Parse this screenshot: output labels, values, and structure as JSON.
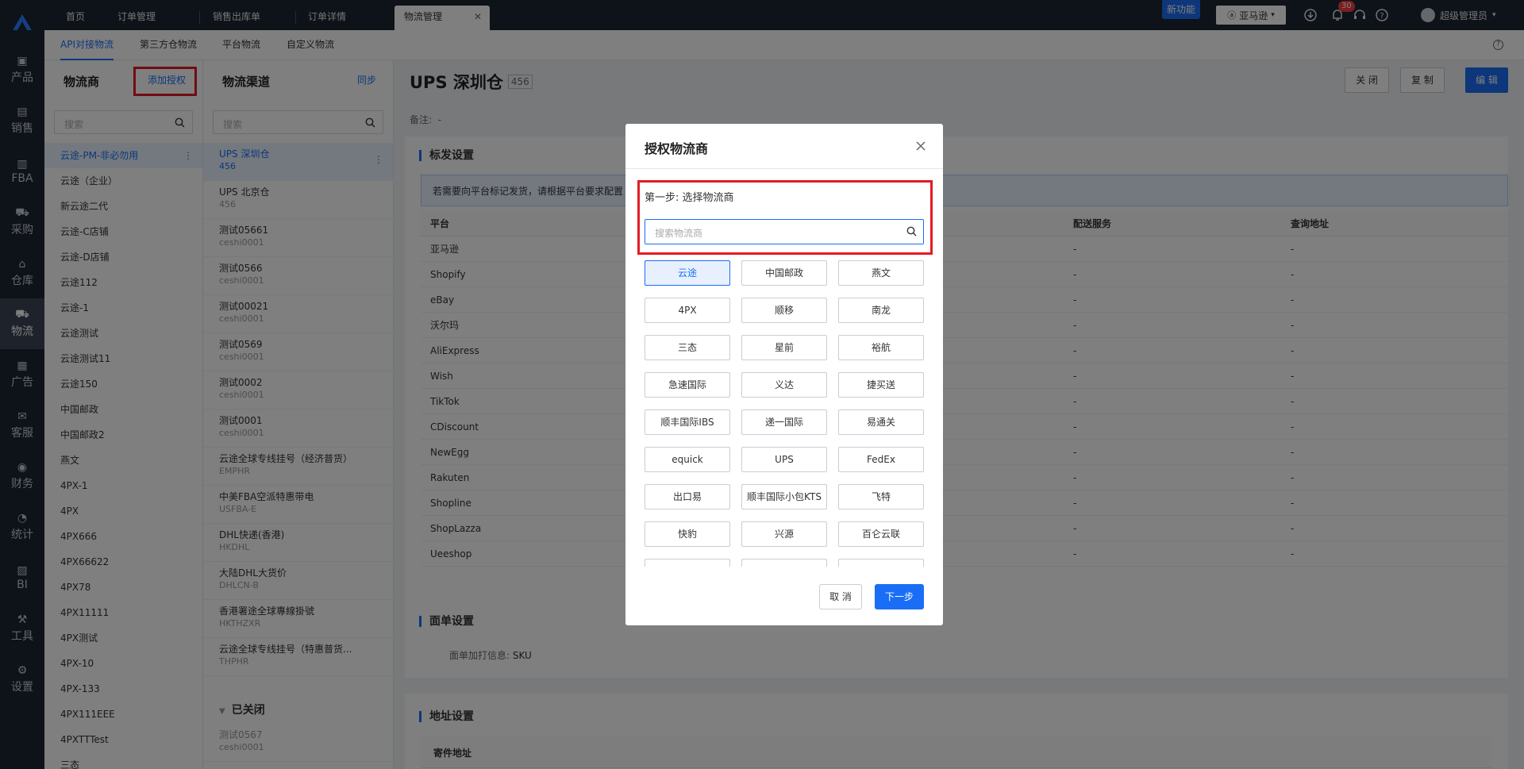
{
  "sidebar": {
    "items": [
      {
        "label": "产品",
        "icon": "box-icon"
      },
      {
        "label": "销售",
        "icon": "sale-icon"
      },
      {
        "label": "FBA",
        "icon": "fba-icon"
      },
      {
        "label": "采购",
        "icon": "cart-icon"
      },
      {
        "label": "仓库",
        "icon": "warehouse-icon"
      },
      {
        "label": "物流",
        "icon": "truck-icon"
      },
      {
        "label": "广告",
        "icon": "ad-icon"
      },
      {
        "label": "客服",
        "icon": "mail-icon"
      },
      {
        "label": "财务",
        "icon": "finance-icon"
      },
      {
        "label": "统计",
        "icon": "pie-chart-icon"
      },
      {
        "label": "BI",
        "icon": "bi-icon"
      },
      {
        "label": "工具",
        "icon": "tool-icon"
      },
      {
        "label": "设置",
        "icon": "gear-icon"
      }
    ]
  },
  "topbar": {
    "tabs": [
      "首页",
      "订单管理",
      "销售出库单",
      "订单详情",
      "物流管理"
    ],
    "new_feature": "新功能",
    "platform": "亚马逊",
    "notification_count": "30",
    "user": "超级管理员"
  },
  "subnav": {
    "tabs": [
      "API对接物流",
      "第三方仓物流",
      "平台物流",
      "自定义物流"
    ]
  },
  "carriers_panel": {
    "title": "物流商",
    "add_label": "添加授权",
    "search_placeholder": "搜索",
    "items": [
      "云途-PM-非必勿用",
      "云途（企业）",
      "新云途二代",
      "云途-C店铺",
      "云途-D店铺",
      "云途112",
      "云途-1",
      "云途测试",
      "云途测试11",
      "云途150",
      "中国邮政",
      "中国邮政2",
      "燕文",
      "4PX-1",
      "4PX",
      "4PX666",
      "4PX66622",
      "4PX78",
      "4PX11111",
      "4PX测试",
      "4PX-10",
      "4PX-133",
      "4PX111EEE",
      "4PXTTTest",
      "三态"
    ]
  },
  "channels_panel": {
    "title": "物流渠道",
    "sync_label": "同步",
    "search_placeholder": "搜索",
    "items": [
      {
        "name": "UPS 深圳仓",
        "sub": "456"
      },
      {
        "name": "UPS 北京仓",
        "sub": "456"
      },
      {
        "name": "测试05661",
        "sub": "ceshi0001"
      },
      {
        "name": "测试0566",
        "sub": "ceshi0001"
      },
      {
        "name": "测试00021",
        "sub": "ceshi0001"
      },
      {
        "name": "测试0569",
        "sub": "ceshi0001"
      },
      {
        "name": "测试0002",
        "sub": "ceshi0001"
      },
      {
        "name": "测试0001",
        "sub": "ceshi0001"
      },
      {
        "name": "云途全球专线挂号（经济普货）",
        "sub": "EMPHR"
      },
      {
        "name": "中美FBA空派特惠带电",
        "sub": "USFBA-E"
      },
      {
        "name": "DHL快递(香港)",
        "sub": "HKDHL"
      },
      {
        "name": "大陆DHL大货价",
        "sub": "DHLCN-B"
      },
      {
        "name": "香港署途全球專線掛號",
        "sub": "HKTHZXR"
      },
      {
        "name": "云途全球专线挂号（特惠普货...",
        "sub": "THPHR"
      }
    ],
    "closed_header": "已关闭",
    "closed_items": [
      {
        "name": "测试0567",
        "sub": "ceshi0001"
      }
    ]
  },
  "main": {
    "title": "UPS 深圳仓",
    "count": "456",
    "buttons": {
      "close": "关 闭",
      "copy": "复 制",
      "edit": "编 辑"
    },
    "remark_label": "备注:",
    "remark_value": "-",
    "shipping": {
      "title": "标发设置",
      "info": "若需要向平台标记发货，请根据平台要求配置",
      "columns": [
        "平台",
        "配送服务",
        "查询地址"
      ],
      "rows": [
        "亚马逊",
        "Shopify",
        "eBay",
        "沃尔玛",
        "AliExpress",
        "Wish",
        "TikTok",
        "CDiscount",
        "NewEgg",
        "Rakuten",
        "Shopline",
        "ShopLazza",
        "Ueeshop"
      ],
      "empty": "-"
    },
    "label_settings": {
      "title": "面单设置",
      "field": "面单加打信息:",
      "value": "SKU"
    },
    "address": {
      "title": "地址设置",
      "sender": "寄件地址"
    }
  },
  "modal": {
    "title": "授权物流商",
    "step": "第一步: 选择物流商",
    "search_placeholder": "搜索物流商",
    "carriers": [
      "云途",
      "中国邮政",
      "燕文",
      "4PX",
      "顺移",
      "南龙",
      "三态",
      "星前",
      "裕航",
      "急速国际",
      "义达",
      "捷买送",
      "顺丰国际IBS",
      "递一国际",
      "易通关",
      "equick",
      "UPS",
      "FedEx",
      "出口易",
      "顺丰国际小包KTS",
      "飞特",
      "快豹",
      "兴源",
      "百仑云联"
    ],
    "selected": "云途",
    "cancel": "取 消",
    "next": "下一步"
  },
  "colors": {
    "accent": "#1a6ef5",
    "highlight": "#e31b23",
    "sidebar": "#1d2433"
  }
}
